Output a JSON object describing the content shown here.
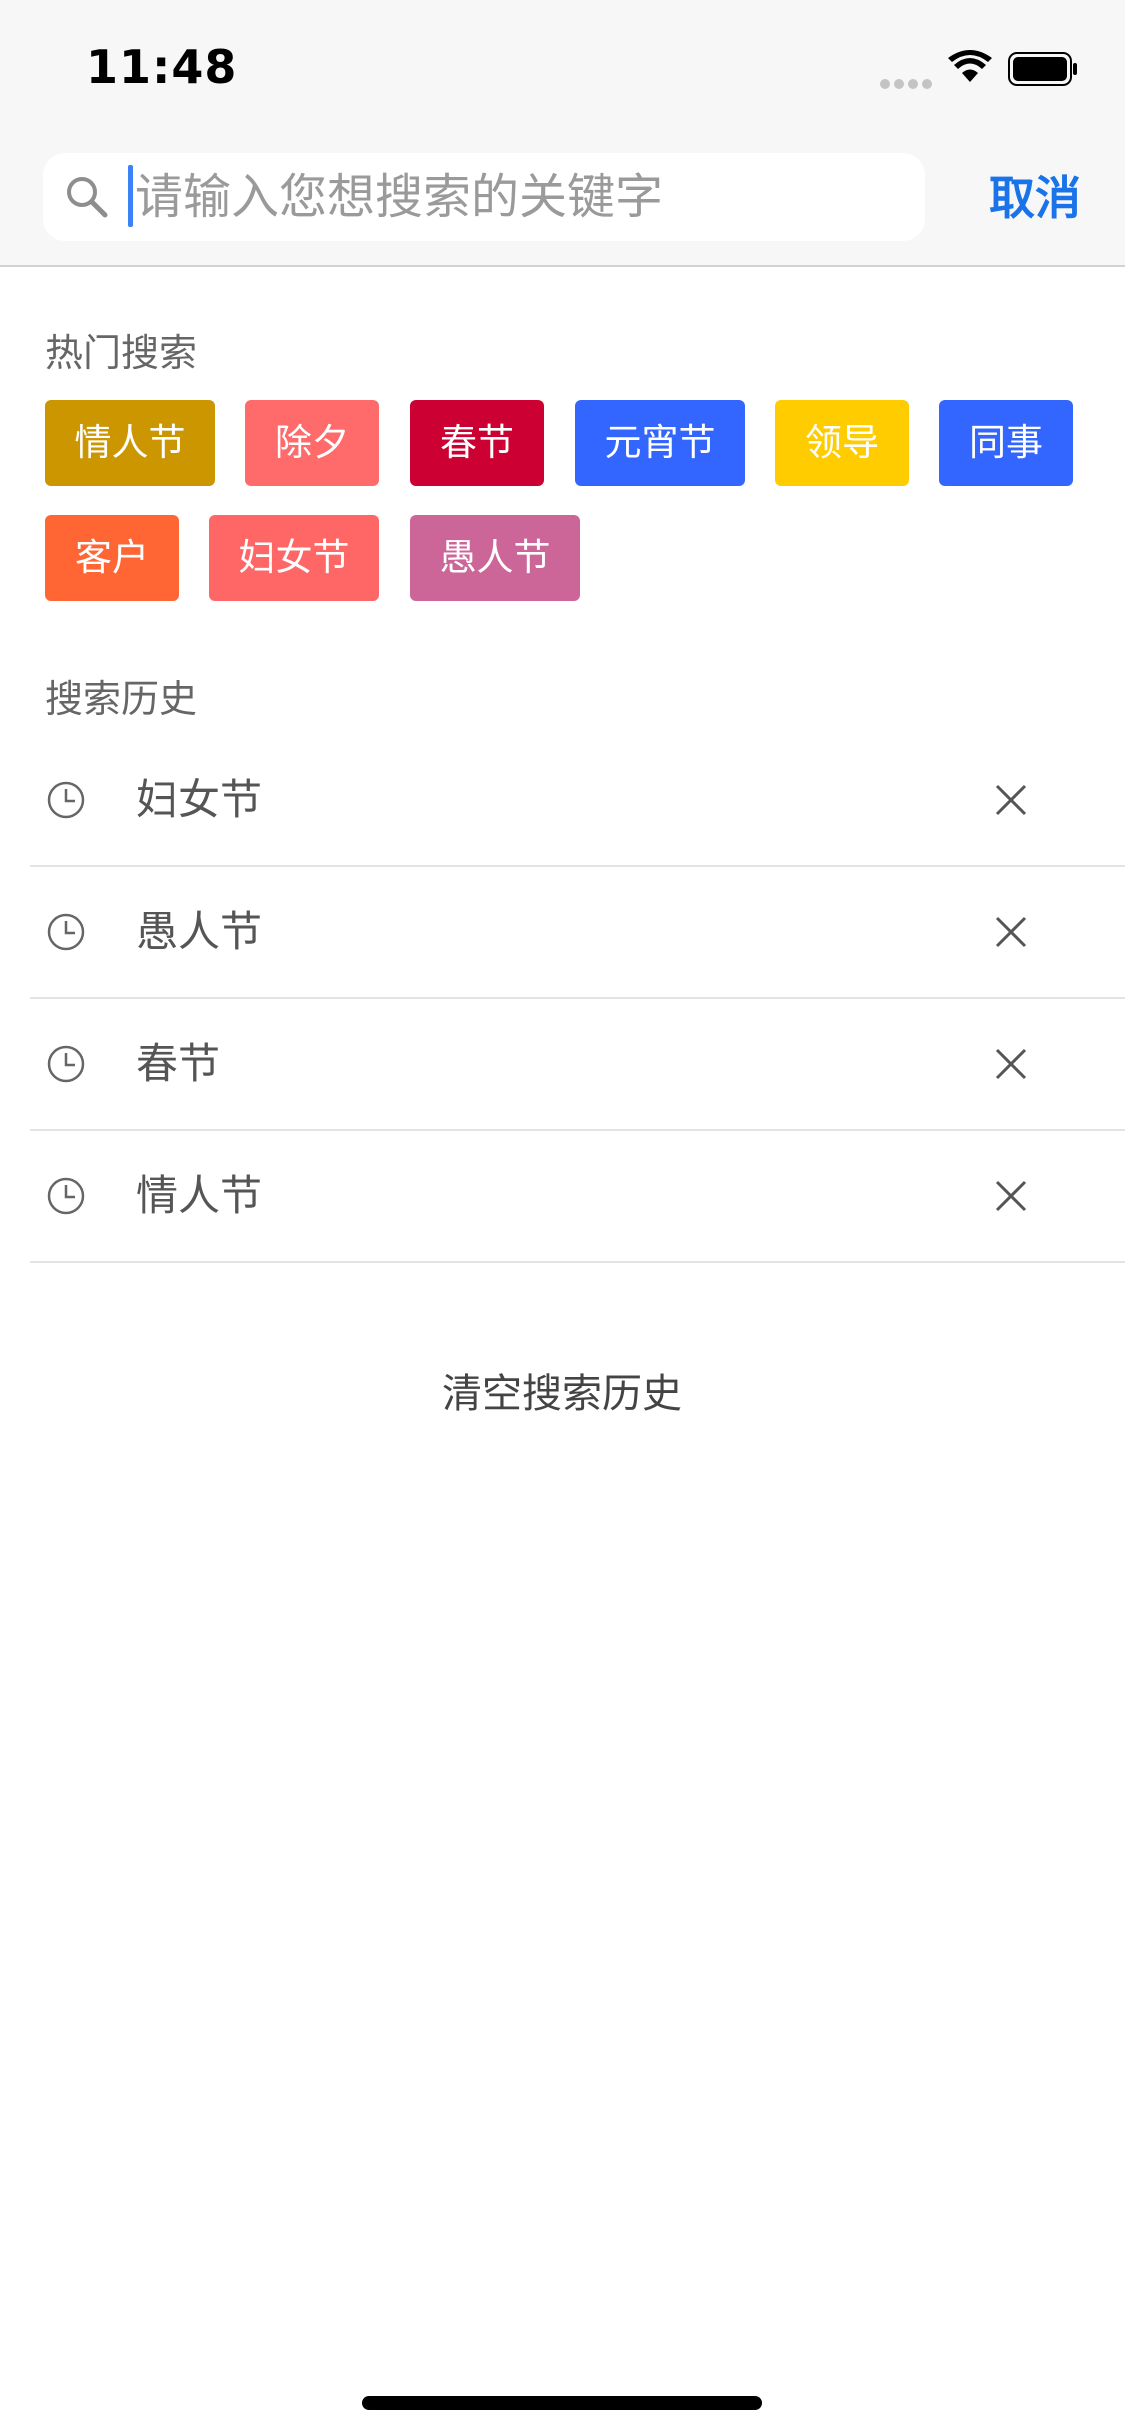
{
  "status_bar": {
    "time": "11:48"
  },
  "search": {
    "placeholder": "请输入您想搜索的关键字",
    "value": "",
    "cancel_label": "取消"
  },
  "hot_search": {
    "title": "热门搜索",
    "tags": [
      {
        "label": "情人节",
        "color": "#cc9600"
      },
      {
        "label": "除夕",
        "color": "#ff6b6b"
      },
      {
        "label": "春节",
        "color": "#cc0033"
      },
      {
        "label": "元宵节",
        "color": "#3366ff"
      },
      {
        "label": "领导",
        "color": "#ffcc00"
      },
      {
        "label": "同事",
        "color": "#3366ff"
      },
      {
        "label": "客户",
        "color": "#ff6633"
      },
      {
        "label": "妇女节",
        "color": "#ff6666"
      },
      {
        "label": "愚人节",
        "color": "#cc6699"
      }
    ]
  },
  "history": {
    "title": "搜索历史",
    "items": [
      {
        "label": "妇女节"
      },
      {
        "label": "愚人节"
      },
      {
        "label": "春节"
      },
      {
        "label": "情人节"
      }
    ],
    "clear_label": "清空搜索历史"
  }
}
